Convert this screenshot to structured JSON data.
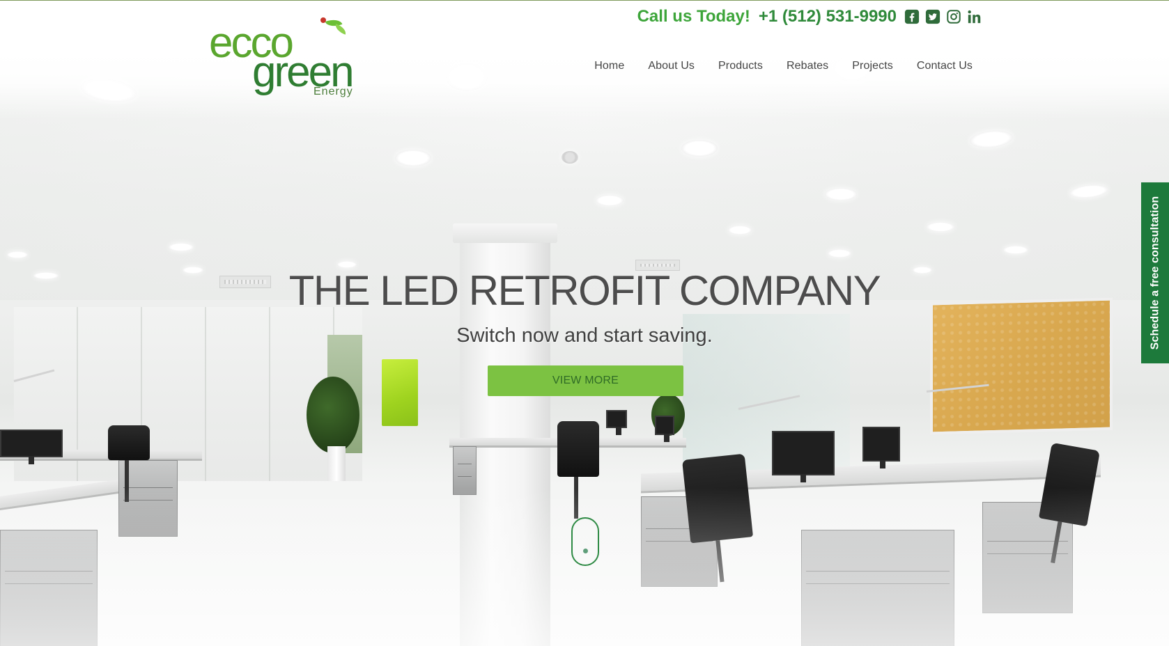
{
  "brand": {
    "logo_line1": "ecco",
    "logo_line2": "green",
    "logo_sub": "Energy",
    "colors": {
      "primary": "#2f8a3a",
      "accent": "#7cc242",
      "dark_green": "#1d7a3b"
    }
  },
  "topbar": {
    "call_label": "Call us Today!",
    "phone": "+1 (512) 531-9990",
    "social": [
      "facebook-icon",
      "twitter-icon",
      "instagram-icon",
      "linkedin-icon"
    ]
  },
  "nav": {
    "items": [
      {
        "label": "Home"
      },
      {
        "label": "About Us"
      },
      {
        "label": "Products"
      },
      {
        "label": "Rebates"
      },
      {
        "label": "Projects"
      },
      {
        "label": "Contact Us"
      }
    ]
  },
  "hero": {
    "title": "THE LED RETROFIT COMPANY",
    "subtitle": "Switch now and start saving.",
    "cta_label": "VIEW MORE"
  },
  "side_tab": {
    "label": "Schedule a free consultation"
  }
}
